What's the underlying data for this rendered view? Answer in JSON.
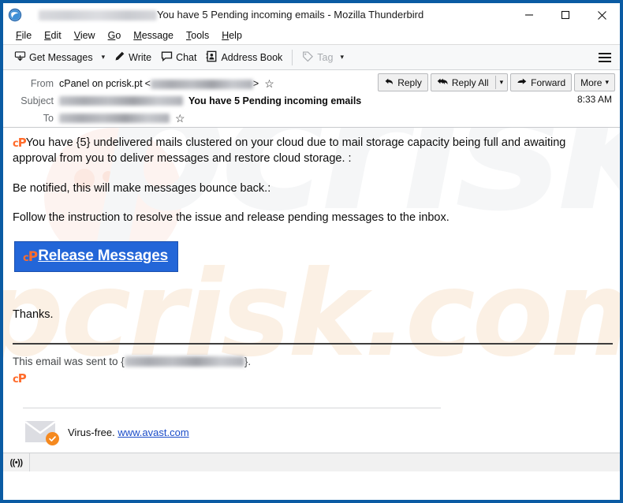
{
  "window": {
    "title": "You have 5 Pending incoming emails - Mozilla Thunderbird",
    "app_icon": "thunderbird-icon",
    "minimize": "minimize-icon",
    "maximize": "maximize-icon",
    "close": "close-icon",
    "border_color": "#0a5ba3"
  },
  "menubar": {
    "items": [
      {
        "label": "File",
        "accel": "F"
      },
      {
        "label": "Edit",
        "accel": "E"
      },
      {
        "label": "View",
        "accel": "V"
      },
      {
        "label": "Go",
        "accel": "G"
      },
      {
        "label": "Message",
        "accel": "M"
      },
      {
        "label": "Tools",
        "accel": "T"
      },
      {
        "label": "Help",
        "accel": "H"
      }
    ]
  },
  "toolbar": {
    "get_messages": "Get Messages",
    "write": "Write",
    "chat": "Chat",
    "address_book": "Address Book",
    "tag": "Tag",
    "menu_button": "app-menu-icon"
  },
  "message_header": {
    "from_label": "From",
    "from_name": "cPanel on pcrisk.pt",
    "from_email_redacted": true,
    "subject_label": "Subject",
    "subject_prefix_redacted": true,
    "subject": "You have 5 Pending incoming emails",
    "to_label": "To",
    "to_redacted": true,
    "time": "8:33 AM",
    "actions": {
      "reply": "Reply",
      "reply_all": "Reply All",
      "forward": "Forward",
      "more": "More"
    }
  },
  "body": {
    "brand_logo": "cP",
    "paragraph_1": "You have {5} undelivered mails clustered on your cloud due to mail storage capacity being full and awaiting approval from you to deliver messages and restore cloud storage. :",
    "paragraph_2": "Be notified, this will make messages bounce back.:",
    "paragraph_3": "Follow the instruction to resolve the issue and release pending messages to the inbox.",
    "cta_label": "Release Messages",
    "cta_color": "#2366d8",
    "thanks": "Thanks.",
    "sent_to_prefix": "This email was sent to {",
    "sent_to_suffix": "}.",
    "sent_to_redacted": true,
    "watermark": "pcrisk.com",
    "accent_color": "#ff6c2c"
  },
  "avast_footer": {
    "text": "Virus-free.",
    "link": "www.avast.com",
    "icon": "envelope-check-icon",
    "badge_color": "#f5891f"
  },
  "statusbar": {
    "indicator": "((•))"
  }
}
